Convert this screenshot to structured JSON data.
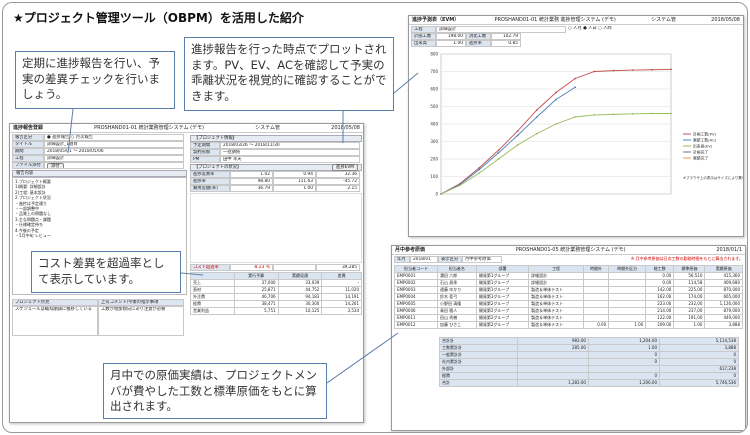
{
  "heading": "★プロジェクト管理ツール（OBPM）を活用した紹介",
  "callouts": {
    "report": "定期に進捗報告を行い、予実の差異チェックを行いましょう。",
    "evm": "進捗報告を行った時点でプロットされます。PV、EV、ACを確認して予実の乖離状況を視覚的に確認することができます。",
    "cost": "コスト差異を超過率として表示しています。",
    "genka": "月中での原価実績は、プロジェクトメンバが費やした工数と標準原価をもとに算出されます。"
  },
  "report_window": {
    "title": "進捗報告登録",
    "subtitle": "PROSHAND01-01 統計業務管理システム (デモ)",
    "system": "システム管",
    "date": "2018/05/08",
    "fields": [
      {
        "label": "報告区分",
        "value": "● 進捗報告 ○ 月次報告"
      },
      {
        "label": "タイトル",
        "value": "詳細設計_1週目"
      },
      {
        "label": "期間",
        "value": "2018/05/01 ～ 2018/05/06"
      },
      {
        "label": "工程",
        "value": "詳細設計"
      },
      {
        "label": "ファイル添付",
        "value": "添付"
      }
    ],
    "memo_label": "報告内容",
    "memo_lines": [
      "1.プロジェクト概要",
      "  1)概要: 詳細設計",
      "  2)工程: 基本設計",
      "2.プロジェクト状況",
      "  ・進捗は予定通り",
      "  ・一部調整中",
      "  ・品質上の問題なし",
      "3.主な問題点・課題",
      "  ・仕様確定待ち",
      "4.今後の予定",
      "  ・5月中旬 レビュー"
    ],
    "project_header": "【プロジェクト情報】",
    "project_fields": [
      {
        "label": "予定期間",
        "value": "2018/03/26 ～ 2018/11/30"
      },
      {
        "label": "契約形態",
        "value": "一括請負"
      },
      {
        "label": "PM",
        "value": "田中 幸夫"
      }
    ],
    "progress_header": "【プロジェクトの状況】",
    "evm_button": "進捗EVM",
    "evm_rows": [
      {
        "label": "進捗差異率",
        "v1": "1.02",
        "v2": "0.94",
        "v3": "32.36"
      },
      {
        "label": "進捗率",
        "v1": "98.80",
        "v2": "111.63",
        "v3": "-45.72"
      },
      {
        "label": "費用差額(率)",
        "v1": "36.79",
        "v2": "1.00",
        "v3": "2.15"
      }
    ],
    "cost_header": "コスト超過率",
    "cost_value": "-8.23 ％",
    "cost_total": "39,285",
    "table_headers": [
      "",
      "実行予算",
      "実績見通",
      "差異"
    ],
    "table_rows": [
      [
        "売上",
        "37,000",
        "33,039",
        "-"
      ],
      [
        "直材",
        "25,871",
        "44,752",
        "11,020"
      ],
      [
        "外注費",
        "46,706",
        "94,183",
        "14,191"
      ],
      [
        "経費",
        "38,471",
        "30,300",
        "14,261"
      ],
      [
        "営業利益",
        "5,751",
        "10,125",
        "3,534"
      ]
    ],
    "remarks": [
      "プロジェクト所見",
      "上司コメント/今後の指示事項"
    ],
    "remark_text": [
      "スケジュールは概ね順調に推移している",
      "工数が増加傾向にあり注意が必要"
    ]
  },
  "evm_window": {
    "title": "進捗予測表（EVM）",
    "subtitle": "PROSHAND01-01 統計業務 進捗管理システム (デモ)",
    "system": "システム管",
    "date": "2018/05/08",
    "info": [
      {
        "label": "工程",
        "value": "詳細設計"
      },
      {
        "label": "計画工数",
        "value": "198.00",
        "label2": "消化工数",
        "value2": "102.79"
      },
      {
        "label": "出来高",
        "value": "1.00",
        "label2": "進捗率",
        "value2": "0.85"
      }
    ],
    "radio": "○ 人月 ● 人日 ○ 人時",
    "legend": [
      "計画工数(PV)",
      "実績工数(AC)",
      "出来高(EV)",
      "計画完了",
      "実績完了"
    ],
    "note": "※ブラウザ上の表示はサイズにより異なります。"
  },
  "chart_data": {
    "type": "line",
    "ylim": [
      0,
      800
    ],
    "yticks": [
      "800",
      "700",
      "600",
      "500",
      "400",
      "300",
      "200",
      "100",
      "0"
    ],
    "series": [
      {
        "name": "計画工数(PV)",
        "color": "#c0504d",
        "values": [
          0,
          60,
          150,
          250,
          360,
          480,
          580,
          660,
          700,
          705,
          708,
          710,
          712
        ]
      },
      {
        "name": "実績工数(AC)",
        "color": "#4f81bd",
        "values": [
          0,
          55,
          140,
          235,
          335,
          440,
          540,
          610
        ]
      },
      {
        "name": "出来高(EV)",
        "color": "#9bbb59",
        "values": [
          0,
          50,
          120,
          200,
          280,
          345,
          400,
          440,
          452,
          455,
          458,
          460,
          460
        ]
      }
    ]
  },
  "genka_window": {
    "title": "月中参考原価",
    "subtitle": "PROSHAND01-05 統計業務管理システム (デモ)",
    "date": "2018/01/1",
    "note": "※ 月中参考原価は日次工数の勤務時間をもとに算出されます。",
    "filter": {
      "month_label": "年月",
      "month": "2018/01",
      "type_label": "表示区分",
      "type": "月中参考原価"
    },
    "headers": [
      "担当者コード",
      "担当者名",
      "部署",
      "工程",
      "時間外",
      "時間外区分",
      "総工数",
      "標準原価",
      "実績原価"
    ],
    "rows": [
      [
        "EMP0001",
        "濃田 六郎",
        "開発第1グループ",
        "詳細設計",
        "",
        "",
        "0.00",
        "56,510",
        "415,360"
      ],
      [
        "EMP0002",
        "石山 昌季",
        "開発第1グループ",
        "詳細設計",
        "",
        "",
        "0.00",
        "114,58",
        "409,680"
      ],
      [
        "EMP0003",
        "遠藤 ゆかり",
        "開発第1グループ",
        "製造＆単体テスト",
        "",
        "",
        "142.00",
        "225,00",
        "870,000"
      ],
      [
        "EMP0004",
        "鈴木 亜弓",
        "開発第1グループ",
        "製造＆単体テスト",
        "",
        "",
        "162.00",
        "174,00",
        "665,000"
      ],
      [
        "EMP0005",
        "小野田 清隆",
        "開発第2グループ",
        "製造＆単体テスト",
        "",
        "",
        "223.00",
        "232,00",
        "1,126,000"
      ],
      [
        "EMP0006",
        "青田 雅人",
        "開発第2グループ",
        "製造＆単体テスト",
        "",
        "",
        "214.00",
        "237,00",
        "879,000"
      ],
      [
        "EMP0011",
        "田山 秀樹",
        "開発第2グループ",
        "製造＆単体テスト",
        "",
        "",
        "122.00",
        "191,00",
        "449,000"
      ],
      [
        "EMP0012",
        "加藤 ひさこ",
        "開発第2グループ",
        "製造＆単体テスト",
        "0.00",
        "1.00",
        "209.00",
        "1.00",
        "3,888"
      ]
    ],
    "summary": [
      {
        "label": "合計計",
        "v1": "983.00",
        "v2": "1,204.00",
        "v3": "5,114,538"
      },
      {
        "label": "工数累計計",
        "v1": "285.00",
        "v2": "1.00",
        "v3": "3,888"
      },
      {
        "label": "一般累計計",
        "v1": "",
        "v2": "0",
        "v3": "0"
      },
      {
        "label": "社内累計計",
        "v1": "",
        "v2": "0",
        "v3": "0"
      },
      {
        "label": "外部計",
        "v1": "",
        "v2": "",
        "v3": "617,238"
      },
      {
        "label": "経費",
        "v1": "",
        "v2": "0",
        "v3": "0"
      },
      {
        "label": "合計",
        "v1": "1,283.00",
        "v2": "1,206.00",
        "v3": "5,746,536"
      }
    ]
  }
}
